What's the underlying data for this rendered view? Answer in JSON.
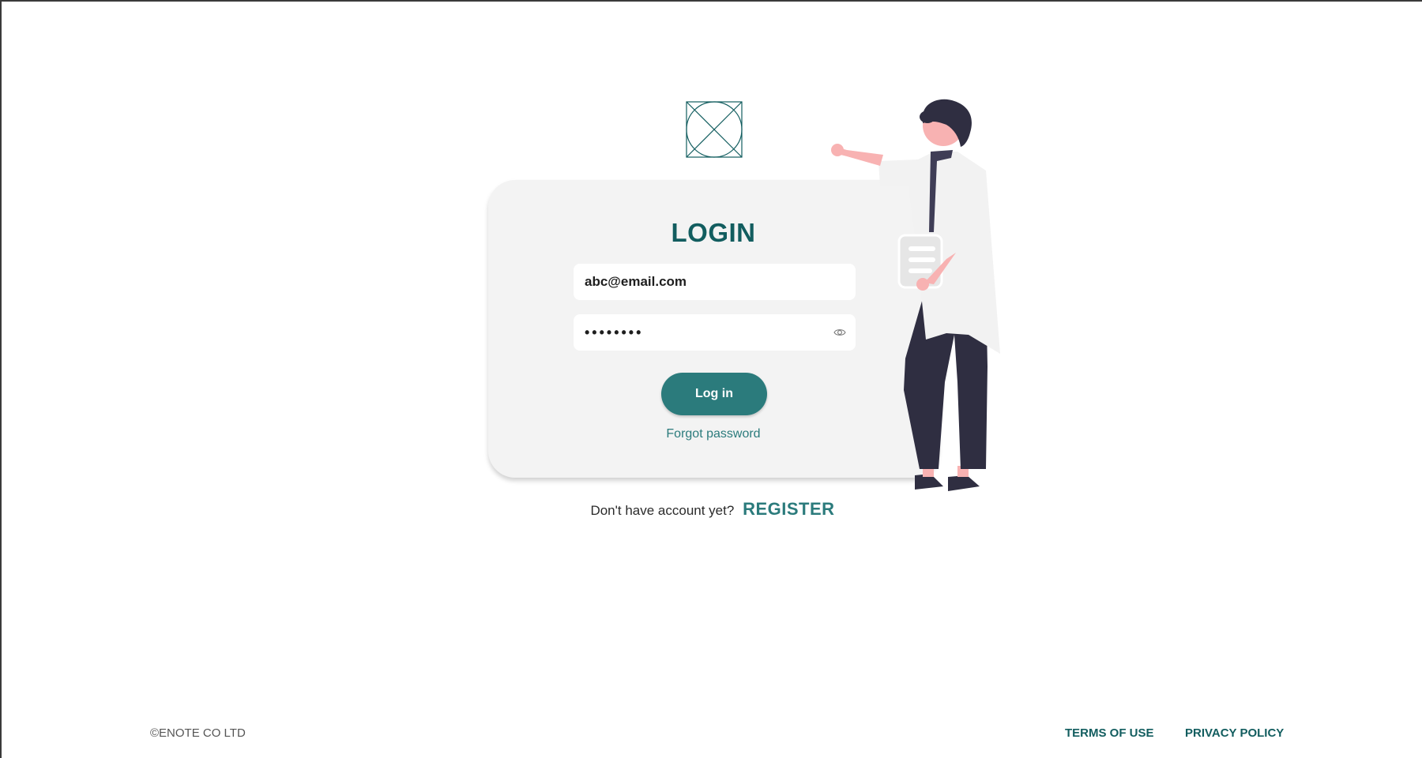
{
  "logo": {
    "icon": "image-placeholder-icon",
    "color": "#125d5f"
  },
  "login": {
    "title": "LOGIN",
    "email_value": "abc@email.com",
    "password_value": "••••••••",
    "show_password_icon": "eye-icon",
    "submit_label": "Log in",
    "forgot_label": "Forgot password"
  },
  "register": {
    "prompt": "Don't have account yet?",
    "link_label": "REGISTER"
  },
  "footer": {
    "copyright": "©ENOTE CO LTD",
    "terms_label": "TERMS OF USE",
    "privacy_label": "PRIVACY POLICY"
  },
  "colors": {
    "brand_dark": "#125d5f",
    "brand_accent": "#2b7b7c",
    "card_background": "#f3f3f3",
    "skin": "#f8b2b2",
    "trousers": "#2f2e41"
  }
}
